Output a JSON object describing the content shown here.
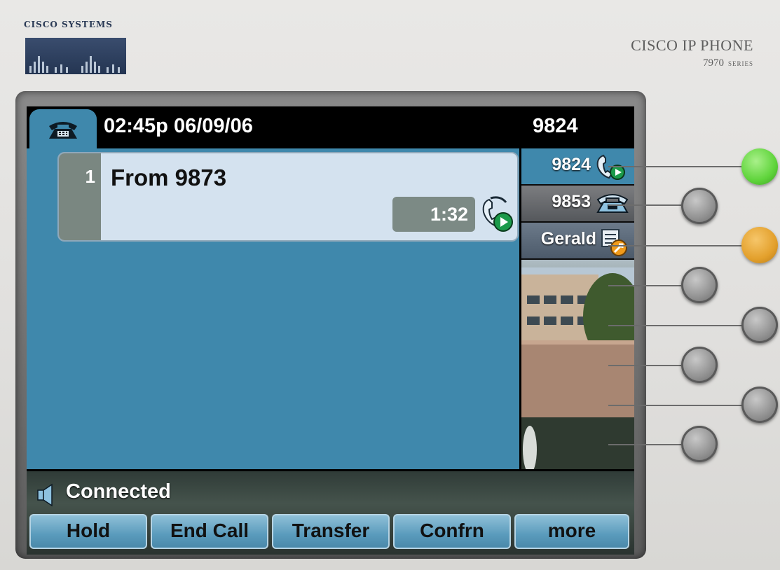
{
  "brand": {
    "company": "CISCO SYSTEMS",
    "model_title": "CISCO IP PHONE",
    "model_number": "7970",
    "model_series": "SERIES"
  },
  "header": {
    "phone_icon": "desk-phone-icon",
    "datetime": "02:45p 06/09/06",
    "extension": "9824"
  },
  "call": {
    "index": "1",
    "title": "From 9873",
    "duration": "1:32",
    "state_icon": "connected-handset-icon"
  },
  "lines": [
    {
      "label": "9824",
      "icon": "connected-handset-icon",
      "active": true
    },
    {
      "label": "9853",
      "icon": "desk-phone-icon",
      "active": false
    },
    {
      "label": "Gerald",
      "icon": "speed-dial-icon",
      "active": false
    }
  ],
  "status": {
    "icon": "speaker-icon",
    "text": "Connected"
  },
  "softkeys": [
    {
      "label": "Hold"
    },
    {
      "label": "End Call"
    },
    {
      "label": "Transfer"
    },
    {
      "label": "Confrn"
    },
    {
      "label": "more"
    }
  ],
  "colors": {
    "screen_blue": "#3f88ac",
    "line_button_active": "#5fd43b",
    "line_button_alert": "#e3a02c",
    "softkey": "#5a9bbc"
  }
}
